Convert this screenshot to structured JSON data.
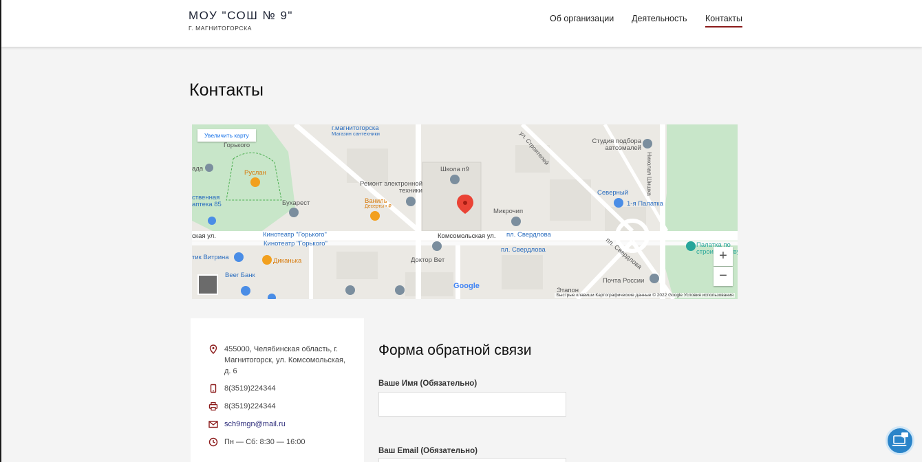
{
  "header": {
    "title": "МОУ \"СОШ № 9\"",
    "subtitle": "Г. МАГНИТОГОРСКА",
    "nav": [
      {
        "label": "Об организации"
      },
      {
        "label": "Деятельность"
      },
      {
        "label": "Контакты",
        "active": true
      }
    ]
  },
  "page": {
    "title": "Контакты"
  },
  "map": {
    "enlarge_label": "Увеличить карту",
    "zoom_in": "+",
    "zoom_out": "−",
    "google": "Google",
    "footer": "Быстрые клавиши   Картографические данные © 2022 Google   Условия использования",
    "labels": {
      "l1": "г.магнитогорска",
      "l2": "Магазин сантехники",
      "l3": "Горького",
      "l4": "Руслан",
      "l5": "Бухарест",
      "l6": "Ремонт электронной техники",
      "l7": "Школа п9",
      "l8": "Ваниль",
      "l9": "Десерты • ₽",
      "l10": "Микрочип",
      "l11": "Студия подбора автоэмалей",
      "l12": "Северный",
      "l13": "1-я Палатка",
      "l14": "Николая Шишка",
      "l15": "ул. Строителей",
      "l16": "Кинотеатр \"Горького\"",
      "l17": "Кинотеатр \"Горького\"",
      "l18": "Комсомольская ул.",
      "l19": "пл. Свердлова",
      "l20": "пл. Свердлова",
      "l21": "пл. Свердлова",
      "l22": "Доктор Вет",
      "l23": "Диканька",
      "l24": "Beer Банк",
      "l25": "Почта России",
      "l26": "Палатка по строительству",
      "l27": "ская ул.",
      "l28": "ада",
      "l29": "ственная аптека 85",
      "l30": "тик Витрина",
      "l31": "Этапон"
    }
  },
  "contacts": {
    "address": "455000, Челябинская область, г. Магнитогорск, ул. Комсомольская, д. 6",
    "phone": "8(3519)224344",
    "fax": "8(3519)224344",
    "email": "sch9mgn@mail.ru",
    "hours": "Пн — Сб: 8:30 — 16:00"
  },
  "form": {
    "title": "Форма обратной связи",
    "name_label": "Ваше Имя (Обязательно)",
    "name_value": "",
    "email_label": "Ваш Email (Обязательно)",
    "email_value": ""
  },
  "colors": {
    "accent": "#8b1a1a",
    "link": "#1a73e8",
    "help": "#2a84c9"
  }
}
